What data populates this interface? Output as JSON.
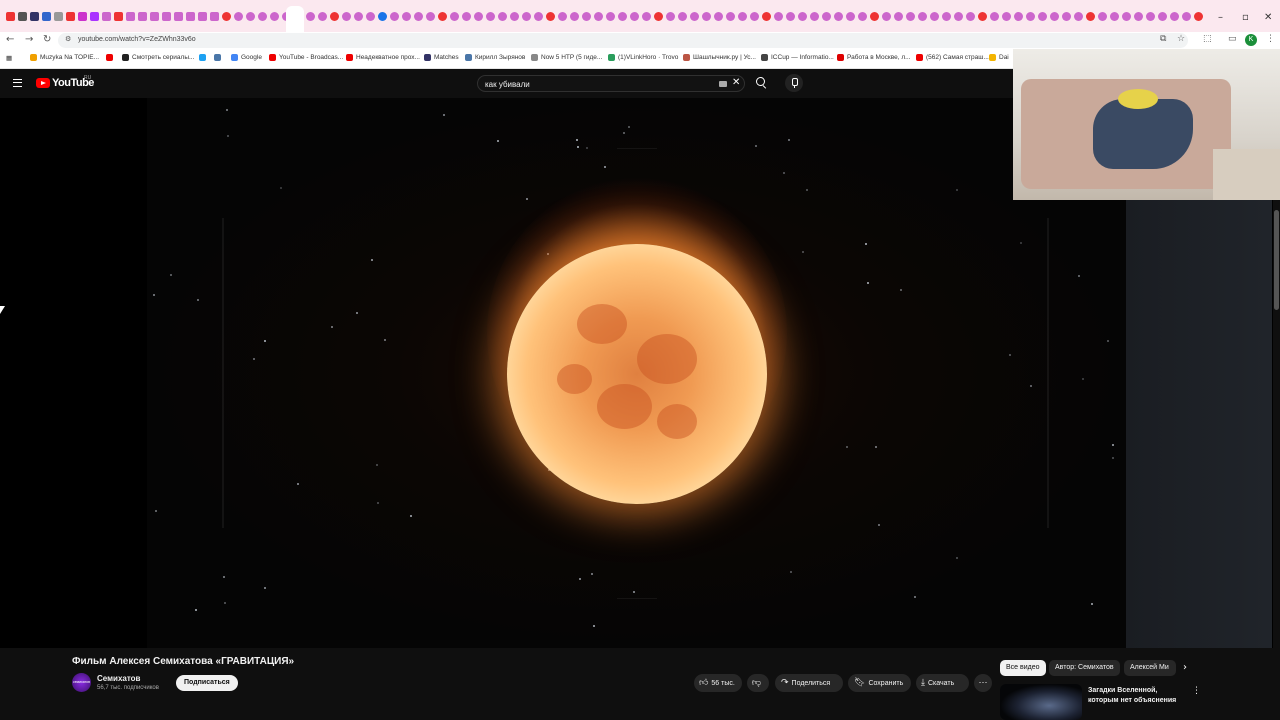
{
  "browser": {
    "url": "youtube.com/watch?v=ZeZWhn33v6o",
    "bookmarks": [
      "Muzyka Na TOPIE...",
      "Смотреть сериалы...",
      "Google",
      "YouTube - Broadcas...",
      "Неадекватное прох...",
      "Matches",
      "Кирилл Зырянов",
      "Now 5 HTP (5 гиде...",
      "(1)VLinkHoro · Trovo",
      "Шашлычник.ру | Ус...",
      "ICCup — Informatio...",
      "Работа в Москве, л...",
      "(562) Самая страш...",
      "Dai"
    ],
    "profile_initial": "K"
  },
  "youtube": {
    "logo_text": "YouTube",
    "region": "RU",
    "search_value": "как убивали",
    "video": {
      "title": "Фильм Алексея Семихатова «ГРАВИТАЦИЯ»",
      "channel": "Семихатов",
      "channel_avatar_text": "семихатов",
      "subscribers": "56,7 тыс. подписчиков",
      "subscribe_label": "Подписаться",
      "likes": "56 тыс.",
      "share_label": "Поделиться",
      "save_label": "Сохранить",
      "download_label": "Скачать"
    },
    "chips": [
      "Все видео",
      "Автор: Семихатов",
      "Алексей Ми"
    ],
    "recommendation": {
      "title": "Загадки Вселенной, которым нет объяснения"
    }
  }
}
